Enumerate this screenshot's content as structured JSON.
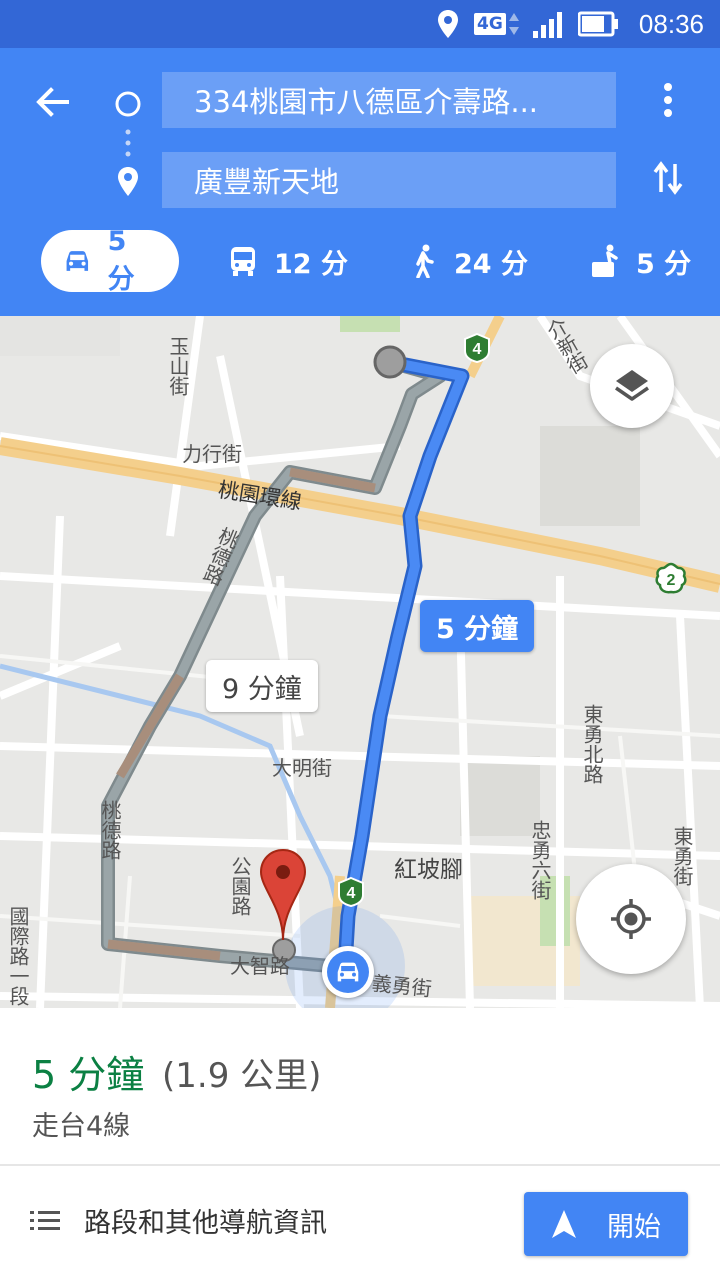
{
  "status_bar": {
    "network": "4G",
    "time": "08:36",
    "icons": [
      "location-icon",
      "network-4g-icon",
      "signal-icon",
      "battery-icon"
    ]
  },
  "header": {
    "origin": "334桃園市八德區介壽路...",
    "destination": "廣豐新天地",
    "icons": [
      "back-arrow-icon",
      "origin-circle-icon",
      "destination-pin-icon",
      "more-vert-icon",
      "swap-icon"
    ],
    "modes": [
      {
        "name": "drive",
        "time": "5 分",
        "active": true
      },
      {
        "name": "transit",
        "time": "12 分",
        "active": false
      },
      {
        "name": "walk",
        "time": "24 分",
        "active": false
      },
      {
        "name": "ride",
        "time": "5 分",
        "active": false
      }
    ]
  },
  "map": {
    "labels": {
      "yushan": "玉山街",
      "lixing": "力行街",
      "taoyuan_ring": "桃園環線",
      "taode_upper": "桃德路",
      "taode_lower": "桃德路",
      "daming": "大明街",
      "hongpojiao": "紅坡腳",
      "gongyuan": "公園路",
      "dazhi": "大智路",
      "yiyong": "義勇街",
      "zhongyong6": "忠勇六街",
      "dongyongbei": "東勇北路",
      "dongyong": "東勇街",
      "guoji": "國際路一段",
      "liuxin": "介新街"
    },
    "route_shields": {
      "top": "4",
      "bottom": "4",
      "right": "2"
    },
    "primary_route_time": "5 分鐘",
    "alt_route_time": "9 分鐘",
    "colors": {
      "primary_route": "#4285f4",
      "alt_route": "#9aa5a8",
      "traffic_slow": "#a88e7c",
      "highway": "#f4cf8c",
      "destination_pin": "#db4437"
    }
  },
  "sheet": {
    "duration": "5 分鐘",
    "distance": "(1.9 公里)",
    "via": "走台4線",
    "steps_label": "路段和其他導航資訊",
    "start_label": "開始"
  }
}
